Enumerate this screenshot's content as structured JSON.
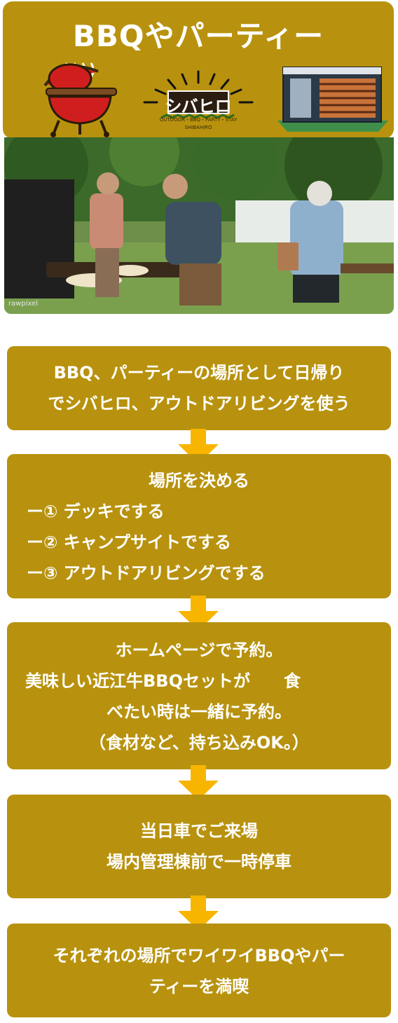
{
  "header": {
    "title": "BBQやパーティー",
    "logo_name": "シバヒロ",
    "logo_tagline": "OUTDOOR・BBQ・PARTY・STAY",
    "logo_romaji": "SHIBAHIRO"
  },
  "photo": {
    "watermark": "rawpixel"
  },
  "steps": [
    {
      "lines": [
        "BBQ、パーティーの場所として日帰り",
        "でシバヒロ、アウトドアリビングを使う"
      ]
    },
    {
      "lines": [
        "場所を決める",
        "ー① デッキでする",
        "ー② キャンプサイトでする",
        "ー③ アウトドアリビングでする"
      ]
    },
    {
      "lines": [
        "ホームページで予約。",
        "美味しい近江牛BBQセットが　　食",
        "べたい時は一緒に予約。",
        "（食材など、持ち込みOK。）"
      ]
    },
    {
      "lines": [
        "当日車でご来場",
        "場内管理棟前で一時停車"
      ]
    },
    {
      "lines": [
        "それぞれの場所でワイワイBBQやパー",
        "ティーを満喫"
      ]
    }
  ],
  "colors": {
    "box": "#b8920e",
    "arrow": "#f7b500",
    "text": "#ffffff"
  }
}
